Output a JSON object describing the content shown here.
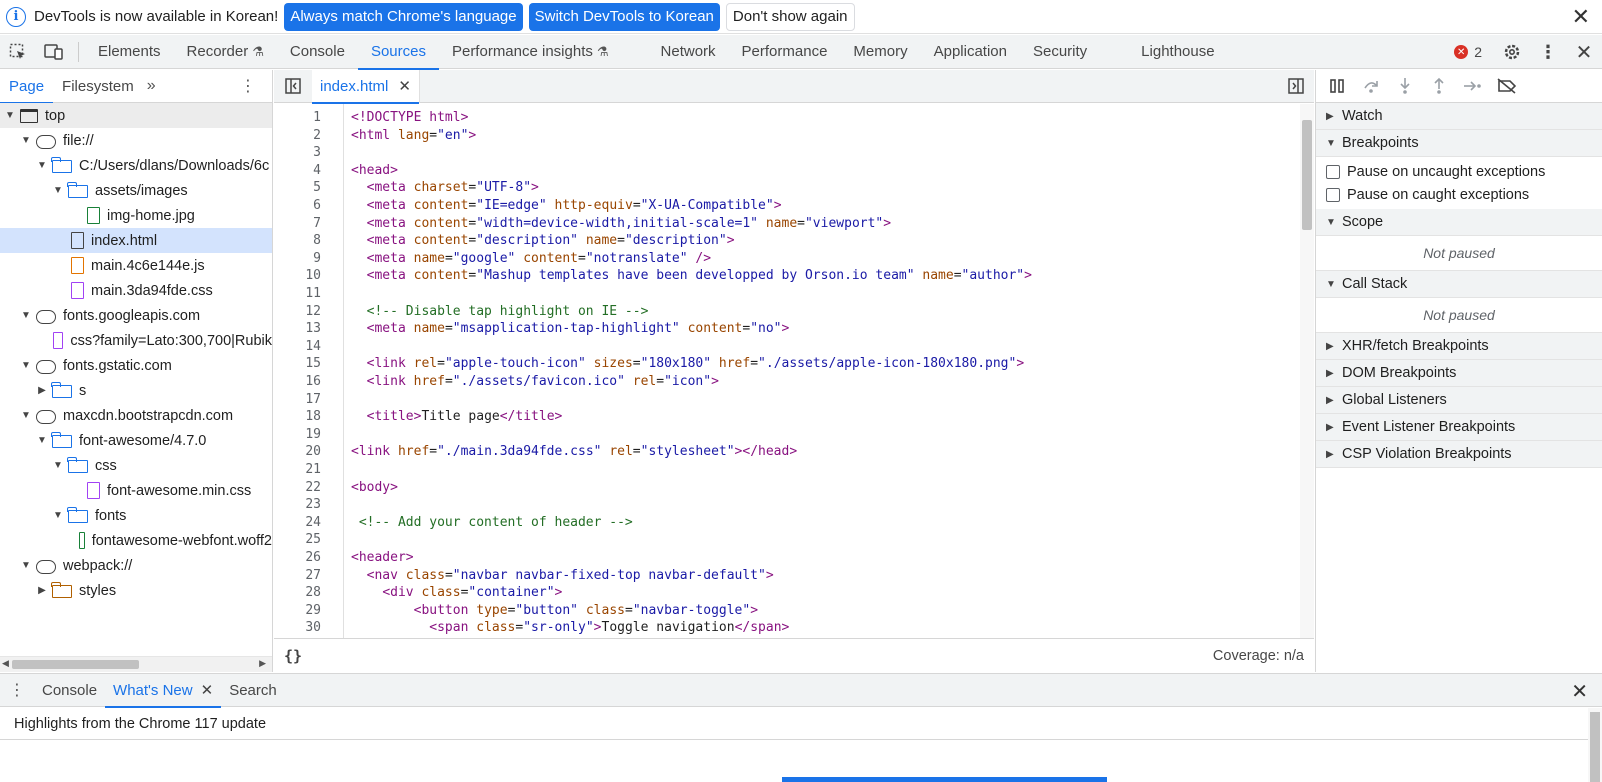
{
  "infobar": {
    "message": "DevTools is now available in Korean!",
    "btn_match": "Always match Chrome's language",
    "btn_switch": "Switch DevTools to Korean",
    "btn_dismiss": "Don't show again",
    "close": "✕"
  },
  "main_tabs": [
    "Elements",
    "Recorder",
    "Console",
    "Sources",
    "Performance insights",
    "Network",
    "Performance",
    "Memory",
    "Application",
    "Security",
    "Lighthouse"
  ],
  "active_main_tab": "Sources",
  "error_count": "2",
  "navigator": {
    "tabs": [
      "Page",
      "Filesystem"
    ],
    "more": "»",
    "tree": [
      {
        "label": "top",
        "depth": 0,
        "icon": "frame",
        "arrow": "▼"
      },
      {
        "label": "file://",
        "depth": 1,
        "icon": "cloud",
        "arrow": "▼"
      },
      {
        "label": "C:/Users/dlans/Downloads/6c",
        "depth": 2,
        "icon": "folder",
        "arrow": "▼"
      },
      {
        "label": "assets/images",
        "depth": 3,
        "icon": "folder",
        "arrow": "▼"
      },
      {
        "label": "img-home.jpg",
        "depth": 4,
        "icon": "file-green",
        "arrow": ""
      },
      {
        "label": "index.html",
        "depth": 3,
        "icon": "file-gray",
        "arrow": ""
      },
      {
        "label": "main.4c6e144e.js",
        "depth": 3,
        "icon": "file-orange",
        "arrow": ""
      },
      {
        "label": "main.3da94fde.css",
        "depth": 3,
        "icon": "file-purple",
        "arrow": ""
      },
      {
        "label": "fonts.googleapis.com",
        "depth": 1,
        "icon": "cloud",
        "arrow": "▼"
      },
      {
        "label": "css?family=Lato:300,700|Rubik",
        "depth": 2,
        "icon": "file-purple",
        "arrow": ""
      },
      {
        "label": "fonts.gstatic.com",
        "depth": 1,
        "icon": "cloud",
        "arrow": "▼"
      },
      {
        "label": "s",
        "depth": 2,
        "icon": "folder",
        "arrow": "▶"
      },
      {
        "label": "maxcdn.bootstrapcdn.com",
        "depth": 1,
        "icon": "cloud",
        "arrow": "▼"
      },
      {
        "label": "font-awesome/4.7.0",
        "depth": 2,
        "icon": "folder",
        "arrow": "▼"
      },
      {
        "label": "css",
        "depth": 3,
        "icon": "folder",
        "arrow": "▼"
      },
      {
        "label": "font-awesome.min.css",
        "depth": 4,
        "icon": "file-purple",
        "arrow": ""
      },
      {
        "label": "fonts",
        "depth": 3,
        "icon": "folder",
        "arrow": "▼"
      },
      {
        "label": "fontawesome-webfont.woff2",
        "depth": 4,
        "icon": "file-green",
        "arrow": ""
      },
      {
        "label": "webpack://",
        "depth": 1,
        "icon": "cloud",
        "arrow": "▼"
      },
      {
        "label": "styles",
        "depth": 2,
        "icon": "folder-brown",
        "arrow": "▶"
      }
    ]
  },
  "editor": {
    "tab": "index.html",
    "coverage": "Coverage: n/a",
    "pretty_print": "{}",
    "lines": [
      [
        [
          "tg",
          "<!DOCTYPE html>"
        ]
      ],
      [
        [
          "tg",
          "<html "
        ],
        [
          "at",
          "lang"
        ],
        [
          "tx",
          "="
        ],
        [
          "av",
          "\"en\""
        ],
        [
          "tg",
          ">"
        ]
      ],
      [],
      [
        [
          "tg",
          "<head>"
        ]
      ],
      [
        [
          "tx",
          "  "
        ],
        [
          "tg",
          "<meta "
        ],
        [
          "at",
          "charset"
        ],
        [
          "tx",
          "="
        ],
        [
          "av",
          "\"UTF-8\""
        ],
        [
          "tg",
          ">"
        ]
      ],
      [
        [
          "tx",
          "  "
        ],
        [
          "tg",
          "<meta "
        ],
        [
          "at",
          "content"
        ],
        [
          "tx",
          "="
        ],
        [
          "av",
          "\"IE=edge\""
        ],
        [
          "tx",
          " "
        ],
        [
          "at",
          "http-equiv"
        ],
        [
          "tx",
          "="
        ],
        [
          "av",
          "\"X-UA-Compatible\""
        ],
        [
          "tg",
          ">"
        ]
      ],
      [
        [
          "tx",
          "  "
        ],
        [
          "tg",
          "<meta "
        ],
        [
          "at",
          "content"
        ],
        [
          "tx",
          "="
        ],
        [
          "av",
          "\"width=device-width,initial-scale=1\""
        ],
        [
          "tx",
          " "
        ],
        [
          "at",
          "name"
        ],
        [
          "tx",
          "="
        ],
        [
          "av",
          "\"viewport\""
        ],
        [
          "tg",
          ">"
        ]
      ],
      [
        [
          "tx",
          "  "
        ],
        [
          "tg",
          "<meta "
        ],
        [
          "at",
          "content"
        ],
        [
          "tx",
          "="
        ],
        [
          "av",
          "\"description\""
        ],
        [
          "tx",
          " "
        ],
        [
          "at",
          "name"
        ],
        [
          "tx",
          "="
        ],
        [
          "av",
          "\"description\""
        ],
        [
          "tg",
          ">"
        ]
      ],
      [
        [
          "tx",
          "  "
        ],
        [
          "tg",
          "<meta "
        ],
        [
          "at",
          "name"
        ],
        [
          "tx",
          "="
        ],
        [
          "av",
          "\"google\""
        ],
        [
          "tx",
          " "
        ],
        [
          "at",
          "content"
        ],
        [
          "tx",
          "="
        ],
        [
          "av",
          "\"notranslate\""
        ],
        [
          "tg",
          " />"
        ]
      ],
      [
        [
          "tx",
          "  "
        ],
        [
          "tg",
          "<meta "
        ],
        [
          "at",
          "content"
        ],
        [
          "tx",
          "="
        ],
        [
          "av",
          "\"Mashup templates have been developped by Orson.io team\""
        ],
        [
          "tx",
          " "
        ],
        [
          "at",
          "name"
        ],
        [
          "tx",
          "="
        ],
        [
          "av",
          "\"author\""
        ],
        [
          "tg",
          ">"
        ]
      ],
      [],
      [
        [
          "tx",
          "  "
        ],
        [
          "cm",
          "<!-- Disable tap highlight on IE -->"
        ]
      ],
      [
        [
          "tx",
          "  "
        ],
        [
          "tg",
          "<meta "
        ],
        [
          "at",
          "name"
        ],
        [
          "tx",
          "="
        ],
        [
          "av",
          "\"msapplication-tap-highlight\""
        ],
        [
          "tx",
          " "
        ],
        [
          "at",
          "content"
        ],
        [
          "tx",
          "="
        ],
        [
          "av",
          "\"no\""
        ],
        [
          "tg",
          ">"
        ]
      ],
      [],
      [
        [
          "tx",
          "  "
        ],
        [
          "tg",
          "<link "
        ],
        [
          "at",
          "rel"
        ],
        [
          "tx",
          "="
        ],
        [
          "av",
          "\"apple-touch-icon\""
        ],
        [
          "tx",
          " "
        ],
        [
          "at",
          "sizes"
        ],
        [
          "tx",
          "="
        ],
        [
          "av",
          "\"180x180\""
        ],
        [
          "tx",
          " "
        ],
        [
          "at",
          "href"
        ],
        [
          "tx",
          "="
        ],
        [
          "av",
          "\"./assets/apple-icon-180x180.png\""
        ],
        [
          "tg",
          ">"
        ]
      ],
      [
        [
          "tx",
          "  "
        ],
        [
          "tg",
          "<link "
        ],
        [
          "at",
          "href"
        ],
        [
          "tx",
          "="
        ],
        [
          "av",
          "\"./assets/favicon.ico\""
        ],
        [
          "tx",
          " "
        ],
        [
          "at",
          "rel"
        ],
        [
          "tx",
          "="
        ],
        [
          "av",
          "\"icon\""
        ],
        [
          "tg",
          ">"
        ]
      ],
      [],
      [
        [
          "tx",
          "  "
        ],
        [
          "tg",
          "<title>"
        ],
        [
          "tx",
          "Title page"
        ],
        [
          "tg",
          "</title>"
        ]
      ],
      [],
      [
        [
          "tg",
          "<link "
        ],
        [
          "at",
          "href"
        ],
        [
          "tx",
          "="
        ],
        [
          "av",
          "\"./main.3da94fde.css\""
        ],
        [
          "tx",
          " "
        ],
        [
          "at",
          "rel"
        ],
        [
          "tx",
          "="
        ],
        [
          "av",
          "\"stylesheet\""
        ],
        [
          "tg",
          "></head>"
        ]
      ],
      [],
      [
        [
          "tg",
          "<body>"
        ]
      ],
      [],
      [
        [
          "tx",
          " "
        ],
        [
          "cm",
          "<!-- Add your content of header -->"
        ]
      ],
      [],
      [
        [
          "tg",
          "<header>"
        ]
      ],
      [
        [
          "tx",
          "  "
        ],
        [
          "tg",
          "<nav "
        ],
        [
          "at",
          "class"
        ],
        [
          "tx",
          "="
        ],
        [
          "av",
          "\"navbar navbar-fixed-top navbar-default\""
        ],
        [
          "tg",
          ">"
        ]
      ],
      [
        [
          "tx",
          "    "
        ],
        [
          "tg",
          "<div "
        ],
        [
          "at",
          "class"
        ],
        [
          "tx",
          "="
        ],
        [
          "av",
          "\"container\""
        ],
        [
          "tg",
          ">"
        ]
      ],
      [
        [
          "tx",
          "        "
        ],
        [
          "tg",
          "<button "
        ],
        [
          "at",
          "type"
        ],
        [
          "tx",
          "="
        ],
        [
          "av",
          "\"button\""
        ],
        [
          "tx",
          " "
        ],
        [
          "at",
          "class"
        ],
        [
          "tx",
          "="
        ],
        [
          "av",
          "\"navbar-toggle\""
        ],
        [
          "tg",
          ">"
        ]
      ],
      [
        [
          "tx",
          "          "
        ],
        [
          "tg",
          "<span "
        ],
        [
          "at",
          "class"
        ],
        [
          "tx",
          "="
        ],
        [
          "av",
          "\"sr-only\""
        ],
        [
          "tg",
          ">"
        ],
        [
          "tx",
          "Toggle navigation"
        ],
        [
          "tg",
          "</span>"
        ]
      ]
    ]
  },
  "debugger": {
    "sections": {
      "watch": "Watch",
      "breakpoints": "Breakpoints",
      "pause_uncaught": "Pause on uncaught exceptions",
      "pause_caught": "Pause on caught exceptions",
      "scope": "Scope",
      "scope_status": "Not paused",
      "callstack": "Call Stack",
      "callstack_status": "Not paused",
      "xhr": "XHR/fetch Breakpoints",
      "dom": "DOM Breakpoints",
      "global": "Global Listeners",
      "event": "Event Listener Breakpoints",
      "csp": "CSP Violation Breakpoints"
    }
  },
  "drawer": {
    "tabs": [
      "Console",
      "What's New",
      "Search"
    ],
    "active_tab": "What's New",
    "headline": "Highlights from the Chrome 117 update"
  }
}
